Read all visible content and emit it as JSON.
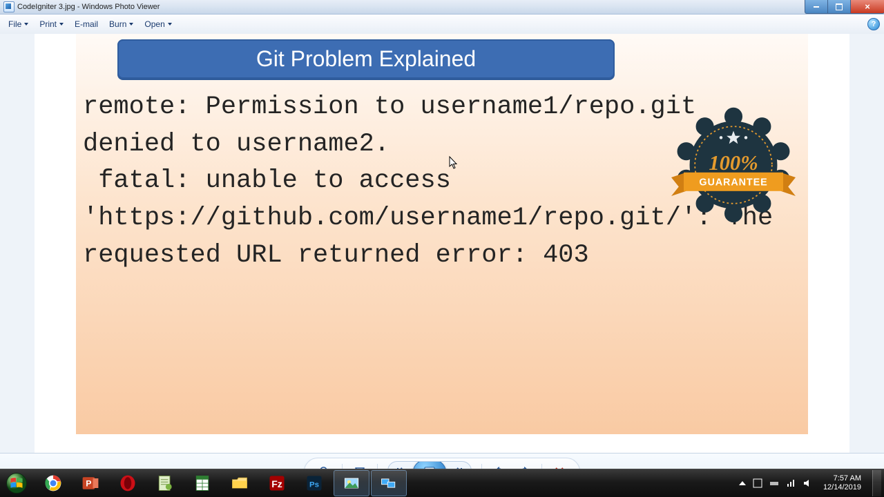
{
  "window": {
    "title": "CodeIgniter 3.jpg - Windows Photo Viewer"
  },
  "menubar": {
    "file": "File",
    "print": "Print",
    "email": "E-mail",
    "burn": "Burn",
    "open": "Open",
    "help": "?"
  },
  "slide": {
    "title": "Git Problem Explained",
    "body": "remote: Permission to username1/repo.git denied to username2.\n fatal: unable to access 'https://github.com/username1/repo.git/': The requested URL returned error: 403",
    "badge_percent": "100%",
    "badge_word": "GUARANTEE"
  },
  "pv": {
    "zoom_icon": "magnifier-icon",
    "fit_icon": "fit-icon",
    "prev_icon": "prev-icon",
    "play_icon": "play-slideshow-icon",
    "next_icon": "next-icon",
    "rotate_ccw_icon": "rotate-ccw-icon",
    "rotate_cw_icon": "rotate-cw-icon",
    "delete_icon": "delete-icon"
  },
  "systray": {
    "time": "7:57 AM",
    "date": "12/14/2019"
  },
  "taskbar": {
    "apps": [
      "start",
      "chrome",
      "powerpoint",
      "opera",
      "notepad++",
      "libreoffice-calc",
      "file-explorer",
      "filezilla",
      "photoshop",
      "photo-viewer",
      "task-view"
    ]
  }
}
